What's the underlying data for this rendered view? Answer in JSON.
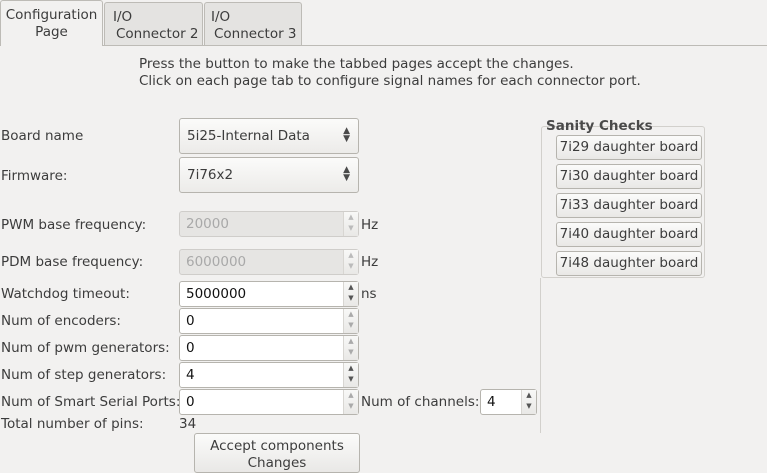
{
  "tabs": [
    {
      "line1": "Configuration",
      "line2": "Page"
    },
    {
      "line1": "I/O",
      "line2": "Connector 2"
    },
    {
      "line1": "I/O",
      "line2": "Connector 3"
    }
  ],
  "intro": {
    "line1": "Press the button to make the tabbed pages accept the changes.",
    "line2": "Click on each page tab to configure signal names for each connector port."
  },
  "board": {
    "label": "Board name",
    "value": "5i25-Internal Data"
  },
  "firmware": {
    "label": "Firmware:",
    "value": "7i76x2"
  },
  "pwm": {
    "label": "PWM base frequency:",
    "value": "20000",
    "unit": "Hz"
  },
  "pdm": {
    "label": "PDM base frequency:",
    "value": "6000000",
    "unit": "Hz"
  },
  "watchdog": {
    "label": "Watchdog timeout:",
    "value": "5000000",
    "unit": "ns"
  },
  "encoders": {
    "label": "Num of encoders:",
    "value": "0"
  },
  "pwmgens": {
    "label": "Num of pwm generators:",
    "value": "0"
  },
  "stepgens": {
    "label": "Num of step generators:",
    "value": "4"
  },
  "sserial": {
    "label": "Num of Smart Serial Ports:",
    "value": "0"
  },
  "channels": {
    "label": "Num of channels:",
    "value": "4"
  },
  "pins": {
    "label": "Total number of pins:",
    "value": "34"
  },
  "sanity": {
    "title": "Sanity Checks",
    "buttons": [
      "7i29 daughter board",
      "7i30 daughter board",
      "7i33 daughter board",
      "7i40 daughter board",
      "7i48 daughter board"
    ]
  },
  "accept": {
    "line1": "Accept  components",
    "line2": "Changes"
  }
}
